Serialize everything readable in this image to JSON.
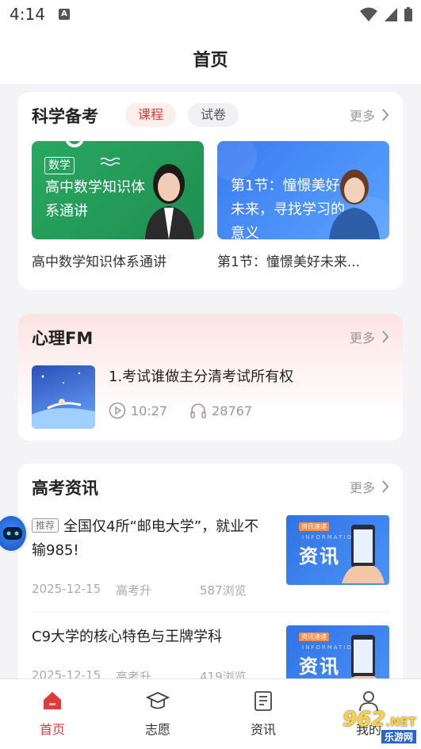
{
  "status_bar": {
    "time": "4:14",
    "notification_icon": "A"
  },
  "header": {
    "title": "首页"
  },
  "science_prep": {
    "title": "科学备考",
    "tabs": [
      {
        "label": "课程",
        "active": true
      },
      {
        "label": "试卷",
        "active": false
      }
    ],
    "more_label": "更多",
    "courses": [
      {
        "subject_tag": "数学",
        "thumb_text": "高中数学知识体系通讲",
        "caption": "高中数学知识体系通讲"
      },
      {
        "thumb_text": "第1节：憧憬美好未来，寻找学习的意义",
        "caption": "第1节：憧憬美好未来..."
      }
    ]
  },
  "psychology_fm": {
    "title": "心理FM",
    "more_label": "更多",
    "item": {
      "title": "1.考试谁做主分清考试所有权",
      "duration": "10:27",
      "listens": "28767"
    }
  },
  "gaokao_news": {
    "title": "高考资讯",
    "more_label": "更多",
    "items": [
      {
        "tag": "推荐",
        "title": "全国仅4所“邮电大学”，就业不输985!",
        "date": "2025-12-15",
        "author": "高考升",
        "views": "587浏览",
        "thumb_text": "资讯",
        "thumb_small": "资讯速递",
        "thumb_sub": "INFORMATION"
      },
      {
        "tag": "",
        "title": "C9大学的核心特色与王牌学科",
        "date": "2025-12-15",
        "author": "高考升",
        "views": "419浏览",
        "thumb_text": "资讯",
        "thumb_small": "资讯速递",
        "thumb_sub": "INFORMATION"
      }
    ]
  },
  "tab_bar": {
    "tabs": [
      {
        "label": "首页",
        "icon": "home-icon",
        "active": true
      },
      {
        "label": "志愿",
        "icon": "graduation-cap-icon",
        "active": false
      },
      {
        "label": "资讯",
        "icon": "document-icon",
        "active": false
      },
      {
        "label": "我的",
        "icon": "user-icon",
        "active": false
      }
    ]
  },
  "watermark": {
    "number": "962",
    "suffix": ".NET",
    "site": "乐游网"
  },
  "colors": {
    "accent": "#e03b3b",
    "tag_bg": "#fdeeee",
    "background": "#f4f4f6"
  }
}
